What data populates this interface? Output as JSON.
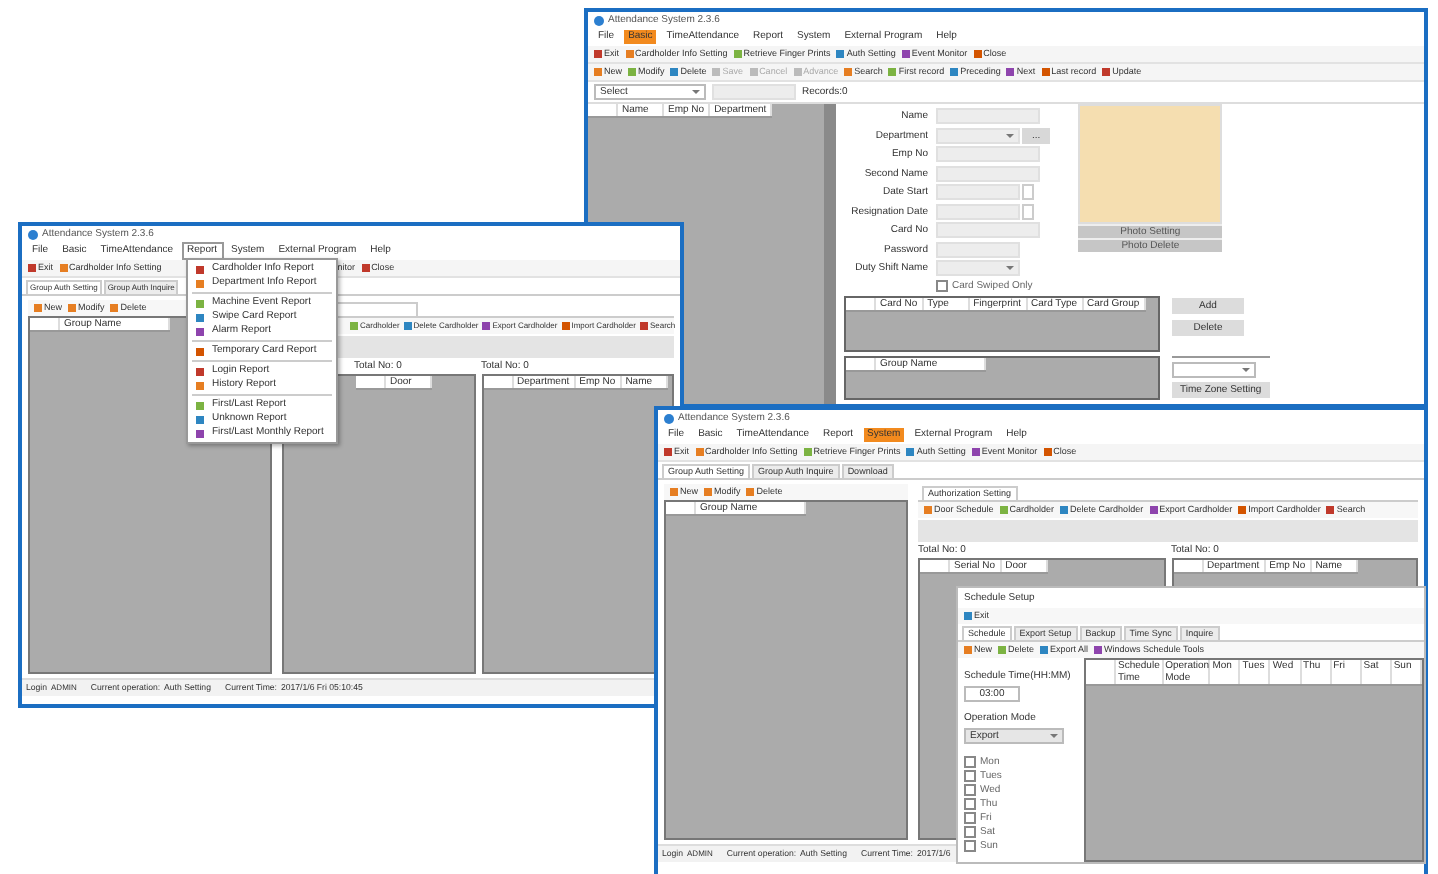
{
  "basic_window": {
    "title": "Attendance System 2.3.6",
    "menu": [
      {
        "label": "File",
        "selected": false
      },
      {
        "label": "Basic",
        "selected": true
      },
      {
        "label": "TimeAttendance",
        "selected": false
      },
      {
        "label": "Report",
        "selected": false
      },
      {
        "label": "System",
        "selected": false
      },
      {
        "label": "External Program",
        "selected": false
      },
      {
        "label": "Help",
        "selected": false
      }
    ],
    "toolbar": [
      "Exit",
      "Cardholder Info Setting",
      "Retrieve Finger Prints",
      "Auth Setting",
      "Event Monitor",
      "Close"
    ],
    "nav_toolbar": [
      {
        "label": "New",
        "disabled": false
      },
      {
        "label": "Modify",
        "disabled": false
      },
      {
        "label": "Delete",
        "disabled": false
      },
      {
        "label": "Save",
        "disabled": true
      },
      {
        "label": "Cancel",
        "disabled": true
      },
      {
        "label": "Advance",
        "disabled": true
      },
      {
        "label": "Search",
        "disabled": false
      },
      {
        "label": "First record",
        "disabled": false
      },
      {
        "label": "Preceding",
        "disabled": false
      },
      {
        "label": "Next",
        "disabled": false
      },
      {
        "label": "Last record",
        "disabled": false
      },
      {
        "label": "Update",
        "disabled": false
      }
    ],
    "select_value": "Select",
    "records": "Records:0",
    "employee_columns": [
      "Name",
      "Emp No",
      "Department"
    ],
    "form_fields": [
      {
        "label": "Name",
        "kind": "text"
      },
      {
        "label": "Department",
        "kind": "combo",
        "button": "..."
      },
      {
        "label": "Emp No",
        "kind": "text"
      },
      {
        "label": "Second Name",
        "kind": "text"
      },
      {
        "label": "Date Start",
        "kind": "date"
      },
      {
        "label": "Resignation Date",
        "kind": "date"
      },
      {
        "label": "Card No",
        "kind": "text"
      },
      {
        "label": "Password",
        "kind": "short"
      },
      {
        "label": "Duty Shift Name",
        "kind": "combo"
      }
    ],
    "card_swiped_only": {
      "label": "Card Swiped Only",
      "checked": false
    },
    "photo_buttons": [
      "Photo Setting",
      "Photo Delete"
    ],
    "card_columns": [
      "Card No",
      "Type",
      "Fingerprint",
      "Card Type",
      "Card Group"
    ],
    "card_buttons": [
      "Add",
      "Delete"
    ],
    "group_columns": [
      "Group Name"
    ],
    "time_zone_button": "Time Zone Setting"
  },
  "report_window": {
    "title": "Attendance System 2.3.6",
    "menu": [
      {
        "label": "File",
        "selected": false
      },
      {
        "label": "Basic",
        "selected": false
      },
      {
        "label": "TimeAttendance",
        "selected": false
      },
      {
        "label": "Report",
        "selected": true
      },
      {
        "label": "System",
        "selected": false
      },
      {
        "label": "External Program",
        "selected": false
      },
      {
        "label": "Help",
        "selected": false
      }
    ],
    "toolbar": [
      "Exit",
      "Cardholder Info Setting"
    ],
    "toolbar_end": [
      "nitor",
      "Close"
    ],
    "tabs": [
      {
        "label": "Group Auth Setting",
        "selected": true
      },
      {
        "label": "Group Auth Inquire",
        "selected": false
      }
    ],
    "left_toolbar": [
      "New",
      "Modify",
      "Delete"
    ],
    "group_columns": [
      "Group Name"
    ],
    "right_toolbar": [
      "Cardholder",
      "Delete Cardholder",
      "Export Cardholder",
      "Import Cardholder",
      "Search"
    ],
    "panels": [
      {
        "title": "Total No: 0",
        "columns": [
          "Door"
        ]
      },
      {
        "title": "Total No: 0",
        "columns": [
          "Department",
          "Emp No",
          "Name"
        ]
      }
    ],
    "status": [
      "Login",
      "ADMIN",
      "Current operation:",
      "Auth Setting",
      "Current Time:",
      "2017/1/6 Fri 05:10:45"
    ],
    "report_menu": [
      {
        "label": "Cardholder Info Report",
        "separator_before": false
      },
      {
        "label": "Department Info Report",
        "separator_before": false
      },
      {
        "label": "Machine Event Report",
        "separator_before": true
      },
      {
        "label": "Swipe Card Report",
        "separator_before": false
      },
      {
        "label": "Alarm Report",
        "separator_before": false
      },
      {
        "label": "Temporary Card Report",
        "separator_before": true
      },
      {
        "label": "Login Report",
        "separator_before": true
      },
      {
        "label": "History Report",
        "separator_before": false
      },
      {
        "label": "First/Last Report",
        "separator_before": true
      },
      {
        "label": "Unknown Report",
        "separator_before": false
      },
      {
        "label": "First/Last Monthly Report",
        "separator_before": false
      }
    ]
  },
  "system_window": {
    "title": "Attendance System 2.3.6",
    "menu": [
      {
        "label": "File",
        "selected": false
      },
      {
        "label": "Basic",
        "selected": false
      },
      {
        "label": "TimeAttendance",
        "selected": false
      },
      {
        "label": "Report",
        "selected": false
      },
      {
        "label": "System",
        "selected": true
      },
      {
        "label": "External Program",
        "selected": false
      },
      {
        "label": "Help",
        "selected": false
      }
    ],
    "toolbar": [
      "Exit",
      "Cardholder Info Setting",
      "Retrieve Finger Prints",
      "Auth Setting",
      "Event Monitor",
      "Close"
    ],
    "tabs": [
      {
        "label": "Group Auth Setting",
        "selected": true
      },
      {
        "label": "Group Auth Inquire",
        "selected": false
      },
      {
        "label": "Download",
        "selected": false
      }
    ],
    "left_toolbar": [
      "New",
      "Modify",
      "Delete"
    ],
    "group_columns": [
      "Group Name"
    ],
    "right_tab": "Authorization Setting",
    "right_toolbar": [
      "Door Schedule",
      "Cardholder",
      "Delete Cardholder",
      "Export Cardholder",
      "Import Cardholder",
      "Search"
    ],
    "panels": [
      {
        "title": "Total No: 0",
        "columns": [
          "Serial No",
          "Door"
        ]
      },
      {
        "title": "Total No: 0",
        "columns": [
          "Department",
          "Emp No",
          "Name"
        ]
      }
    ],
    "status": [
      "Login",
      "ADMIN",
      "Current operation:",
      "Auth Setting",
      "Current Time:",
      "2017/1/6"
    ]
  },
  "schedule_dialog": {
    "title": "Schedule Setup",
    "toolbar": [
      "Exit"
    ],
    "tabs": [
      {
        "label": "Schedule",
        "selected": true
      },
      {
        "label": "Export Setup",
        "selected": false
      },
      {
        "label": "Backup",
        "selected": false
      },
      {
        "label": "Time Sync",
        "selected": false
      },
      {
        "label": "Inquire",
        "selected": false
      }
    ],
    "schedule_toolbar": [
      "New",
      "Delete",
      "Export All",
      "Windows Schedule Tools"
    ],
    "time_label": "Schedule Time(HH:MM)",
    "time_value": "03:00",
    "mode_label": "Operation Mode",
    "mode_value": "Export",
    "days": [
      {
        "label": "Mon",
        "checked": false
      },
      {
        "label": "Tues",
        "checked": false
      },
      {
        "label": "Wed",
        "checked": false
      },
      {
        "label": "Thu",
        "checked": false
      },
      {
        "label": "Fri",
        "checked": false
      },
      {
        "label": "Sat",
        "checked": false
      },
      {
        "label": "Sun",
        "checked": false
      }
    ],
    "grid_columns": [
      "Schedule Time",
      "Operation Mode",
      "Mon",
      "Tues",
      "Wed",
      "Thu",
      "Fri",
      "Sat",
      "Sun"
    ]
  }
}
